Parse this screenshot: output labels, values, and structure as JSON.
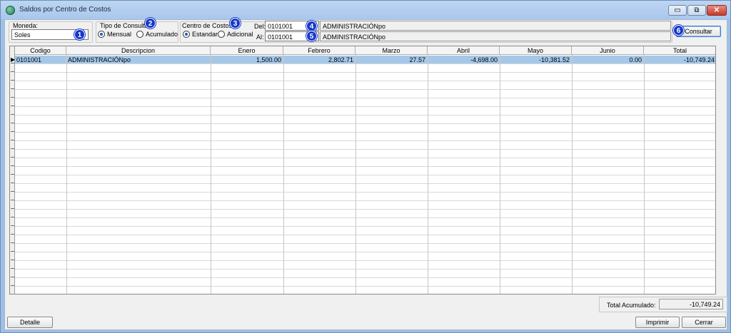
{
  "window": {
    "title": "Saldos por Centro de Costos",
    "minimize": "▭",
    "restore": "⧉",
    "close": "✕"
  },
  "moneda": {
    "label": "Moneda:",
    "value": "Soles",
    "badge": "1"
  },
  "tipo": {
    "label": "Tipo de Consulta:",
    "badge": "2",
    "opt1": "Mensual",
    "opt2": "Acumulado",
    "selected": "Mensual"
  },
  "centro": {
    "label": "Centro de Costos:",
    "badge": "3",
    "opt1": "Estandar",
    "opt2": "Adicional",
    "selected": "Estandar"
  },
  "del": {
    "label": "Del:",
    "code": "0101001",
    "desc": "ADMINISTRACIÓNpo",
    "badge": "4"
  },
  "al": {
    "label": "Al:",
    "code": "0101001",
    "desc": "ADMINISTRACIÓNpo",
    "badge": "5"
  },
  "consultar": {
    "label": "Consultar",
    "badge": "6"
  },
  "table": {
    "headers": [
      "Codigo",
      "Descripcion",
      "Enero",
      "Febrero",
      "Marzo",
      "Abril",
      "Mayo",
      "Junio",
      "Total"
    ],
    "rows": [
      [
        "0101001",
        "ADMINISTRACIÓNpo",
        "1,500.00",
        "2,802.71",
        "27.57",
        "-4,698.00",
        "-10,381.52",
        "0.00",
        "-10,749.24"
      ]
    ]
  },
  "total": {
    "label": "Total Acumulado:",
    "value": "-10,749.24"
  },
  "buttons": {
    "detalle": "Detalle",
    "imprimir": "Imprimir",
    "cerrar": "Cerrar"
  }
}
